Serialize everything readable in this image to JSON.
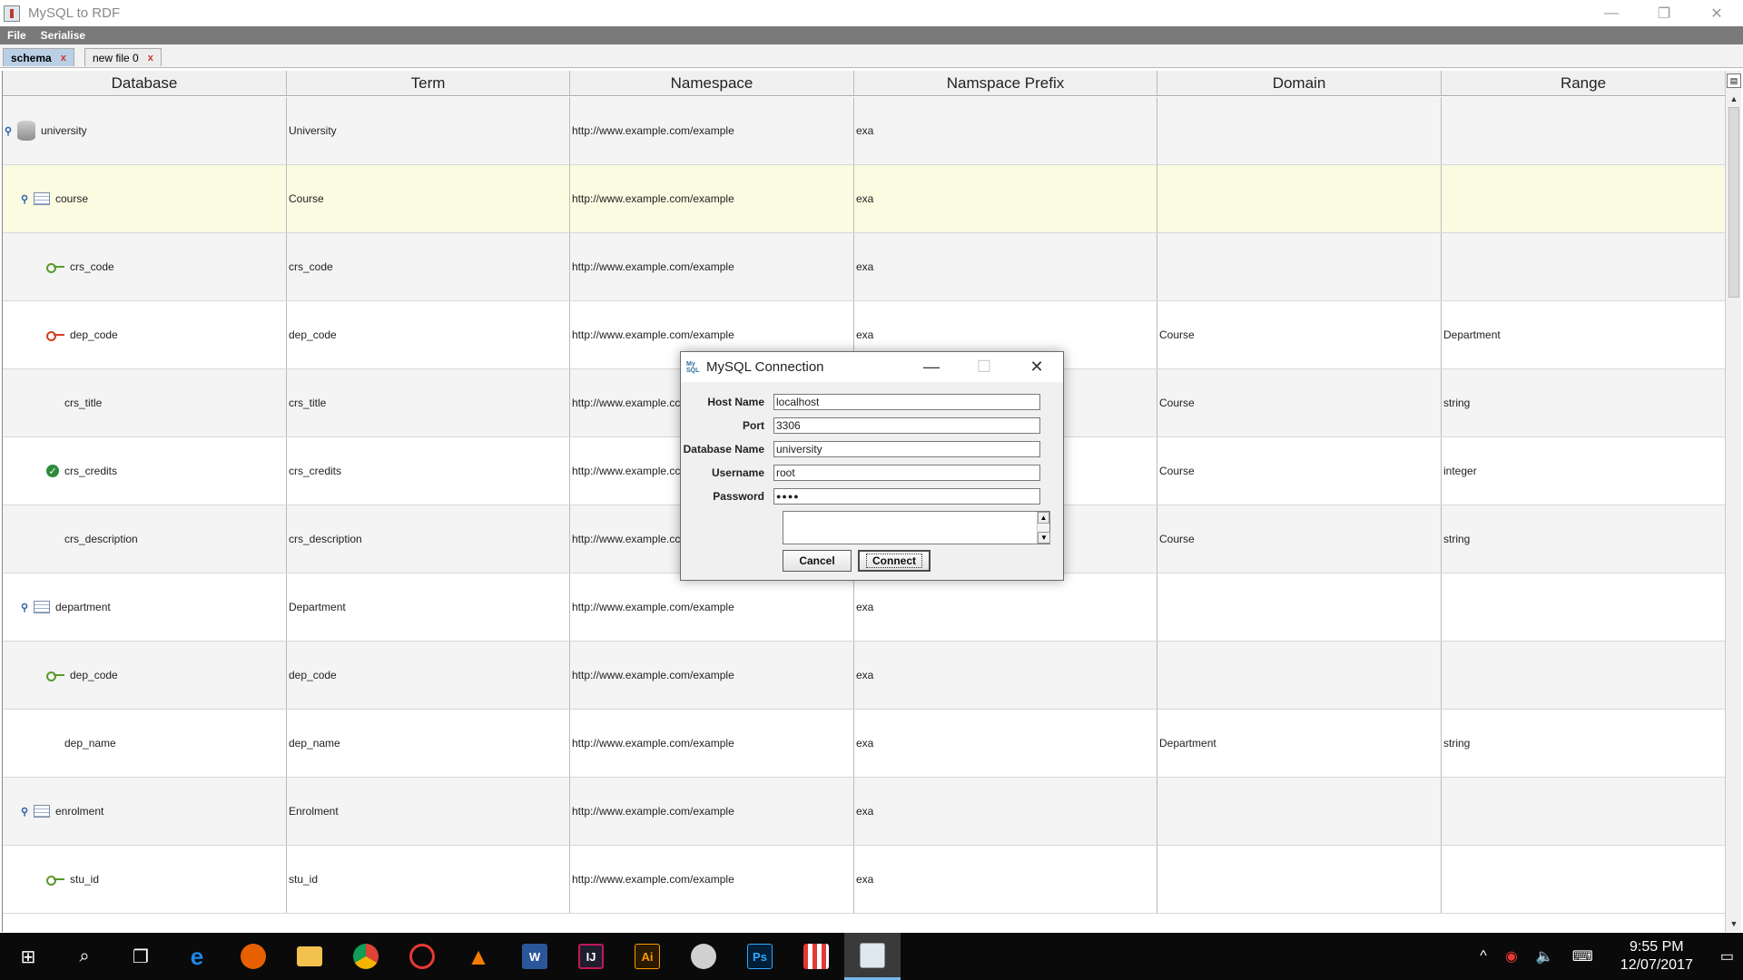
{
  "window": {
    "title": "MySQL to RDF",
    "controls": {
      "minimize": "—",
      "restore": "❐",
      "close": "✕"
    }
  },
  "menu": [
    "File",
    "Serialise"
  ],
  "tabs": [
    {
      "label": "schema",
      "close": "x"
    },
    {
      "label": "new file 0",
      "close": "x"
    }
  ],
  "table": {
    "headers": [
      "Database",
      "Term",
      "Namespace",
      "Namspace Prefix",
      "Domain",
      "Range"
    ],
    "rows": [
      {
        "db": "university",
        "term": "University",
        "ns": "http://www.example.com/example",
        "prefix": "exa",
        "domain": "",
        "range": "",
        "icon": "database-icon"
      },
      {
        "db": "course",
        "term": "Course",
        "ns": "http://www.example.com/example",
        "prefix": "exa",
        "domain": "",
        "range": "",
        "icon": "table-icon"
      },
      {
        "db": "crs_code",
        "term": "crs_code",
        "ns": "http://www.example.com/example",
        "prefix": "exa",
        "domain": "",
        "range": "",
        "icon": "primary-key-icon"
      },
      {
        "db": "dep_code",
        "term": "dep_code",
        "ns": "http://www.example.com/example",
        "prefix": "exa",
        "domain": "Course",
        "range": "Department",
        "icon": "foreign-key-icon"
      },
      {
        "db": "crs_title",
        "term": "crs_title",
        "ns": "http://www.example.cc",
        "prefix": "",
        "domain": "Course",
        "range": "string",
        "icon": ""
      },
      {
        "db": "crs_credits",
        "term": "crs_credits",
        "ns": "http://www.example.cc",
        "prefix": "",
        "domain": "Course",
        "range": "integer",
        "icon": "check-icon"
      },
      {
        "db": "crs_description",
        "term": "crs_description",
        "ns": "http://www.example.cc",
        "prefix": "",
        "domain": "Course",
        "range": "string",
        "icon": ""
      },
      {
        "db": "department",
        "term": "Department",
        "ns": "http://www.example.com/example",
        "prefix": "exa",
        "domain": "",
        "range": "",
        "icon": "table-icon"
      },
      {
        "db": "dep_code",
        "term": "dep_code",
        "ns": "http://www.example.com/example",
        "prefix": "exa",
        "domain": "",
        "range": "",
        "icon": "primary-key-icon"
      },
      {
        "db": "dep_name",
        "term": "dep_name",
        "ns": "http://www.example.com/example",
        "prefix": "exa",
        "domain": "Department",
        "range": "string",
        "icon": ""
      },
      {
        "db": "enrolment",
        "term": "Enrolment",
        "ns": "http://www.example.com/example",
        "prefix": "exa",
        "domain": "",
        "range": "",
        "icon": "table-icon"
      },
      {
        "db": "stu_id",
        "term": "stu_id",
        "ns": "http://www.example.com/example",
        "prefix": "exa",
        "domain": "",
        "range": "",
        "icon": "primary-key-icon"
      }
    ]
  },
  "dialog": {
    "title": "MySQL Connection",
    "icon_text": "My SQL",
    "fields": [
      {
        "label": "Host Name",
        "value": "localhost"
      },
      {
        "label": "Port",
        "value": "3306"
      },
      {
        "label": "Database Name",
        "value": "university"
      },
      {
        "label": "Username",
        "value": "root"
      },
      {
        "label": "Password",
        "value": "●●●●"
      }
    ],
    "cancel": "Cancel",
    "connect": "Connect"
  },
  "taskbar": {
    "time": "9:55 PM",
    "date": "12/07/2017",
    "apps": [
      "IJ",
      "Ai",
      "Ps",
      "W"
    ]
  }
}
